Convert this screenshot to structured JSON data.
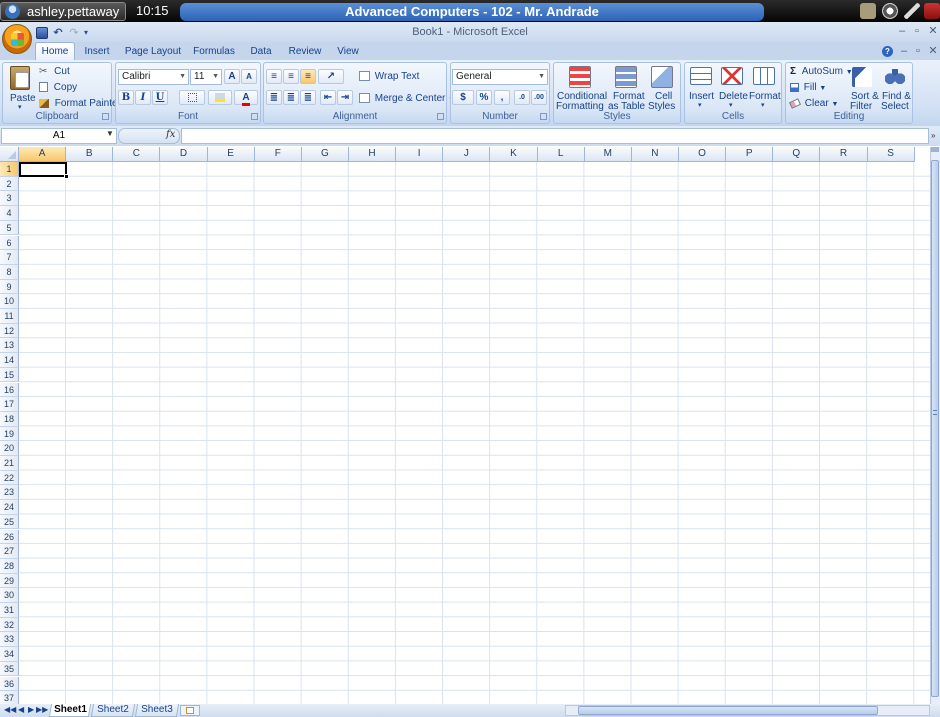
{
  "session": {
    "user": "ashley.pettaway",
    "time": "10:15",
    "title": "Advanced Computers - 102 - Mr. Andrade"
  },
  "window": {
    "doc_title": "Book1 - Microsoft Excel",
    "minimize": "–",
    "restore": "▫",
    "close": "✕"
  },
  "tabs": [
    "Home",
    "Insert",
    "Page Layout",
    "Formulas",
    "Data",
    "Review",
    "View"
  ],
  "ribbon": {
    "clipboard": {
      "label": "Clipboard",
      "paste": "Paste",
      "cut": "Cut",
      "copy": "Copy",
      "format_painter": "Format Painter"
    },
    "font": {
      "label": "Font",
      "name": "Calibri",
      "size": "11",
      "bold": "B",
      "italic": "I",
      "underline": "U",
      "grow": "A",
      "shrink": "A"
    },
    "alignment": {
      "label": "Alignment",
      "wrap_text": "Wrap Text",
      "merge_center": "Merge & Center"
    },
    "number": {
      "label": "Number",
      "format": "General",
      "currency": "$",
      "percent": "%",
      "comma": ","
    },
    "styles": {
      "label": "Styles",
      "conditional": [
        "Conditional",
        "Formatting"
      ],
      "format_table": [
        "Format",
        "as Table"
      ],
      "cell_styles": [
        "Cell",
        "Styles"
      ]
    },
    "cells": {
      "label": "Cells",
      "insert": "Insert",
      "delete": "Delete",
      "format": "Format"
    },
    "editing": {
      "label": "Editing",
      "autosum": "AutoSum",
      "fill": "Fill",
      "clear": "Clear",
      "sort_filter": [
        "Sort &",
        "Filter"
      ],
      "find_select": [
        "Find &",
        "Select"
      ]
    }
  },
  "formula_bar": {
    "name_box": "A1",
    "fx": "fx",
    "value": ""
  },
  "grid": {
    "columns": [
      "A",
      "B",
      "C",
      "D",
      "E",
      "F",
      "G",
      "H",
      "I",
      "J",
      "K",
      "L",
      "M",
      "N",
      "O",
      "P",
      "Q",
      "R",
      "S"
    ],
    "rows": [
      "1",
      "2",
      "3",
      "4",
      "5",
      "6",
      "7",
      "8",
      "9",
      "10",
      "11",
      "12",
      "13",
      "14",
      "15",
      "16",
      "17",
      "18",
      "19",
      "20",
      "21",
      "22",
      "23",
      "24",
      "25",
      "26",
      "27",
      "28",
      "29",
      "30",
      "31",
      "32",
      "33",
      "34",
      "35",
      "36",
      "37"
    ],
    "selected_col": "A",
    "selected_row": "1"
  },
  "sheets": [
    "Sheet1",
    "Sheet2",
    "Sheet3"
  ],
  "active_sheet": "Sheet1",
  "colors": {
    "ribbon_bg": "#d3e1f4",
    "accent": "#15428b",
    "selected_header": "#f8c76c"
  }
}
